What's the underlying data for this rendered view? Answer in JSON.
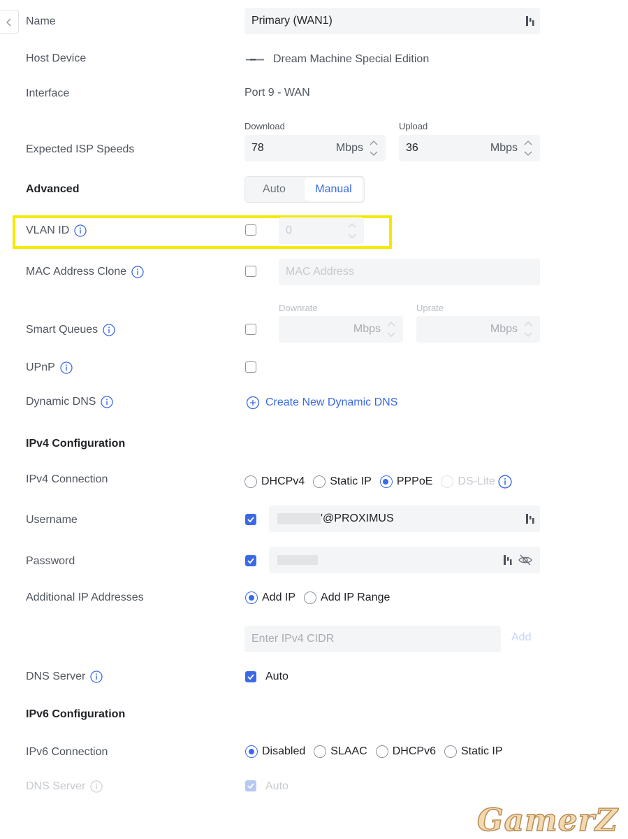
{
  "name": {
    "label": "Name",
    "value": "Primary (WAN1)"
  },
  "host_device": {
    "label": "Host Device",
    "value": "Dream Machine Special Edition"
  },
  "interface": {
    "label": "Interface",
    "value": "Port 9 - WAN"
  },
  "isp_speeds": {
    "label": "Expected ISP Speeds",
    "download": {
      "caption": "Download",
      "value": "78",
      "unit": "Mbps"
    },
    "upload": {
      "caption": "Upload",
      "value": "36",
      "unit": "Mbps"
    }
  },
  "advanced": {
    "label": "Advanced",
    "auto": "Auto",
    "manual": "Manual",
    "selected": "Manual"
  },
  "vlan": {
    "label": "VLAN ID",
    "value": "0",
    "checked": false
  },
  "mac_clone": {
    "label": "MAC Address Clone",
    "placeholder": "MAC Address",
    "checked": false
  },
  "smart_queues": {
    "label": "Smart Queues",
    "checked": false,
    "downrate": {
      "caption": "Downrate",
      "unit": "Mbps"
    },
    "uprate": {
      "caption": "Uprate",
      "unit": "Mbps"
    }
  },
  "upnp": {
    "label": "UPnP",
    "checked": false
  },
  "dynamic_dns": {
    "label": "Dynamic DNS",
    "link": "Create New Dynamic DNS"
  },
  "ipv4": {
    "heading": "IPv4 Configuration",
    "connection": {
      "label": "IPv4 Connection",
      "options": [
        "DHCPv4",
        "Static IP",
        "PPPoE",
        "DS-Lite"
      ],
      "selected": "PPPoE"
    },
    "username": {
      "label": "Username",
      "value_suffix": "'@PROXIMUS",
      "checked": true
    },
    "password": {
      "label": "Password",
      "checked": true
    },
    "additional_ip": {
      "label": "Additional IP Addresses",
      "options": [
        "Add IP",
        "Add IP Range"
      ],
      "selected": "Add IP",
      "placeholder": "Enter IPv4 CIDR",
      "add": "Add"
    },
    "dns": {
      "label": "DNS Server",
      "auto": "Auto",
      "checked": true
    }
  },
  "ipv6": {
    "heading": "IPv6 Configuration",
    "connection": {
      "label": "IPv6 Connection",
      "options": [
        "Disabled",
        "SLAAC",
        "DHCPv6",
        "Static IP"
      ],
      "selected": "Disabled"
    },
    "dns": {
      "label": "DNS Server",
      "auto": "Auto",
      "checked": true
    }
  },
  "watermark": "GamerZ",
  "colors": {
    "accent": "#3a6ae5",
    "highlight": "#f4ea00"
  }
}
